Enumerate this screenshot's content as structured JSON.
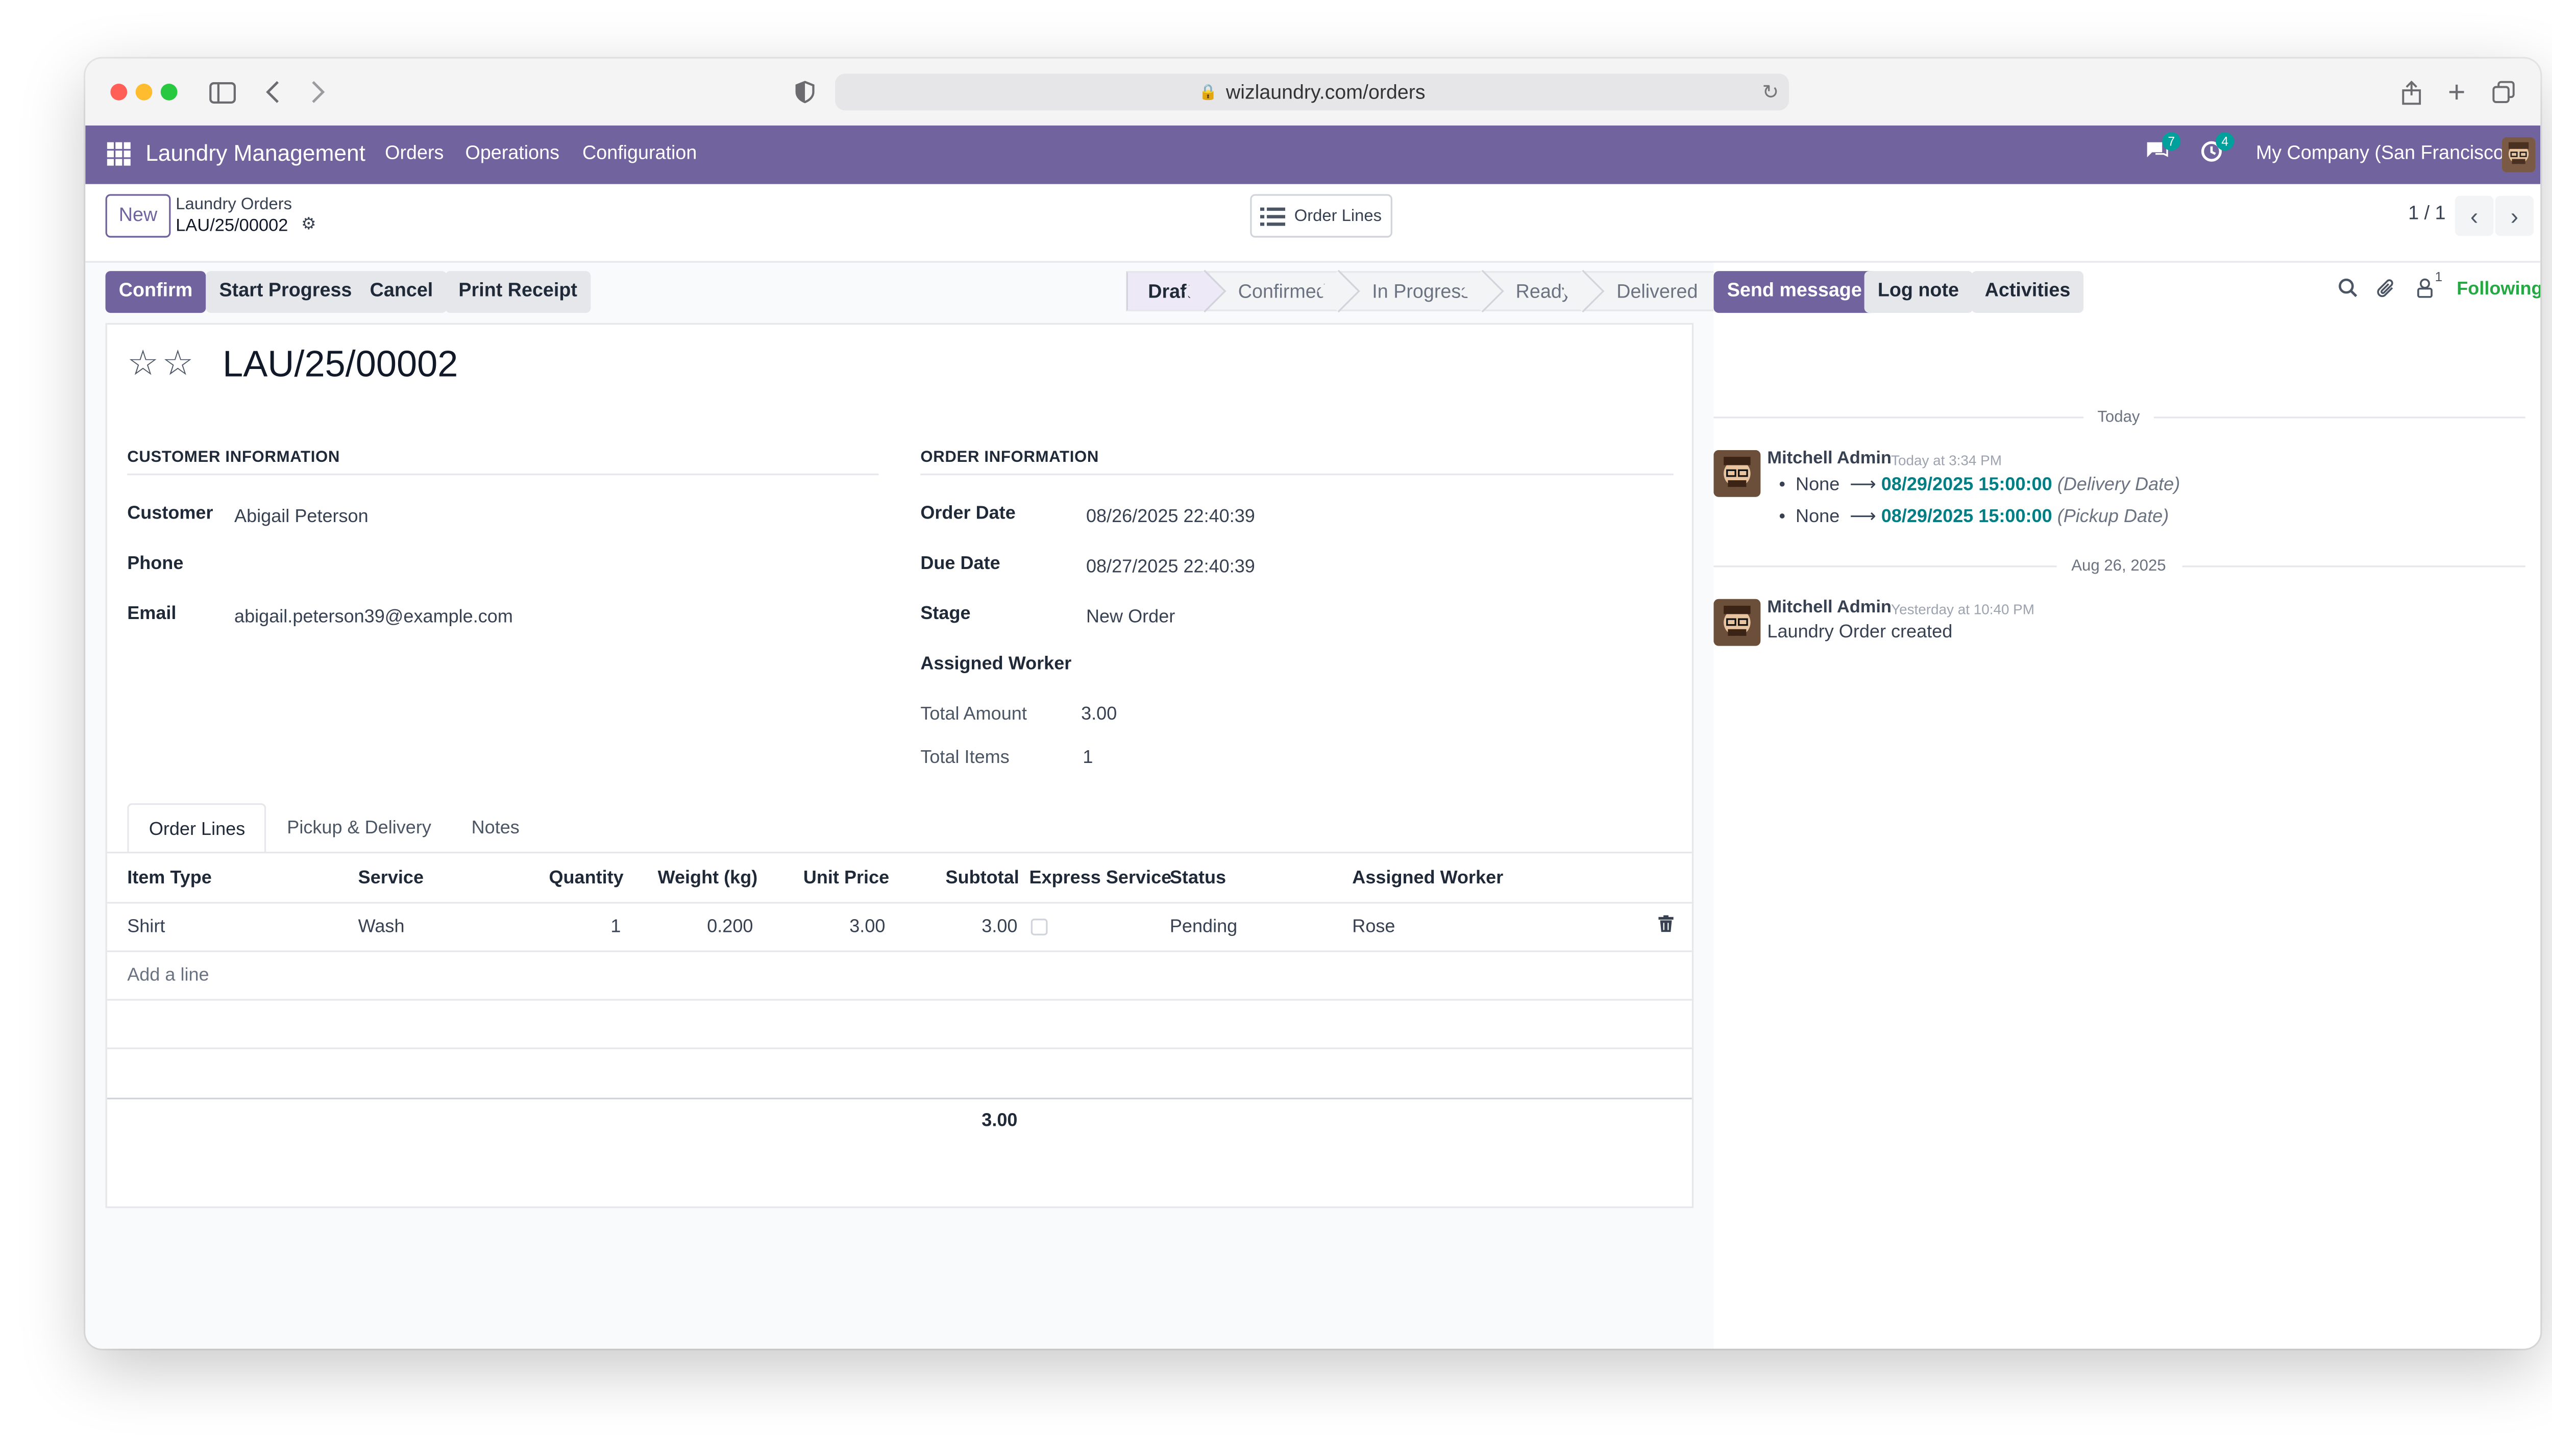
{
  "browser": {
    "url": "wizlaundry.com/orders"
  },
  "navbar": {
    "app_name": "Laundry Management",
    "menu": [
      "Orders",
      "Operations",
      "Configuration"
    ],
    "messages_badge": "7",
    "activities_badge": "4",
    "company": "My Company (San Francisco)",
    "color": "#71639e"
  },
  "control_panel": {
    "new_label": "New",
    "breadcrumb_parent": "Laundry Orders",
    "breadcrumb_current": "LAU/25/00002",
    "order_lines_button": "Order Lines",
    "pager": "1 / 1"
  },
  "actions": {
    "confirm": "Confirm",
    "start_progress": "Start Progress",
    "cancel": "Cancel",
    "print_receipt": "Print Receipt"
  },
  "stages": [
    "Draft",
    "Confirmed",
    "In Progress",
    "Ready",
    "Delivered"
  ],
  "active_stage": "Draft",
  "record": {
    "title": "LAU/25/00002",
    "customer_section": "CUSTOMER INFORMATION",
    "order_section": "ORDER INFORMATION",
    "customer_label": "Customer",
    "customer": "Abigail Peterson",
    "phone_label": "Phone",
    "phone": "",
    "email_label": "Email",
    "email": "abigail.peterson39@example.com",
    "order_date_label": "Order Date",
    "order_date": "08/26/2025 22:40:39",
    "due_date_label": "Due Date",
    "due_date": "08/27/2025 22:40:39",
    "stage_label": "Stage",
    "stage": "New Order",
    "assigned_worker_label": "Assigned Worker",
    "assigned_worker": "",
    "total_amount_label": "Total Amount",
    "total_amount": "3.00",
    "total_items_label": "Total Items",
    "total_items": "1"
  },
  "tabs": [
    "Order Lines",
    "Pickup & Delivery",
    "Notes"
  ],
  "order_lines": {
    "columns": [
      "Item Type",
      "Service",
      "Quantity",
      "Weight (kg)",
      "Unit Price",
      "Subtotal",
      "Express Service",
      "Status",
      "Assigned Worker"
    ],
    "rows": [
      {
        "item_type": "Shirt",
        "service": "Wash",
        "quantity": "1",
        "weight": "0.200",
        "unit_price": "3.00",
        "subtotal": "3.00",
        "express": false,
        "status": "Pending",
        "worker": "Rose"
      }
    ],
    "add_line": "Add a line",
    "total": "3.00"
  },
  "chatter": {
    "send_message": "Send message",
    "log_note": "Log note",
    "activities": "Activities",
    "followers_count": "1",
    "following": "Following",
    "sep_today": "Today",
    "sep_date": "Aug 26, 2025",
    "messages": [
      {
        "author": "Mitchell Admin",
        "time": "Today at 3:34 PM",
        "changes": [
          {
            "old": "None",
            "new": "08/29/2025 15:00:00",
            "field": "(Delivery Date)"
          },
          {
            "old": "None",
            "new": "08/29/2025 15:00:00",
            "field": "(Pickup Date)"
          }
        ]
      },
      {
        "author": "Mitchell Admin",
        "time": "Yesterday at 10:40 PM",
        "body": "Laundry Order created"
      }
    ]
  }
}
